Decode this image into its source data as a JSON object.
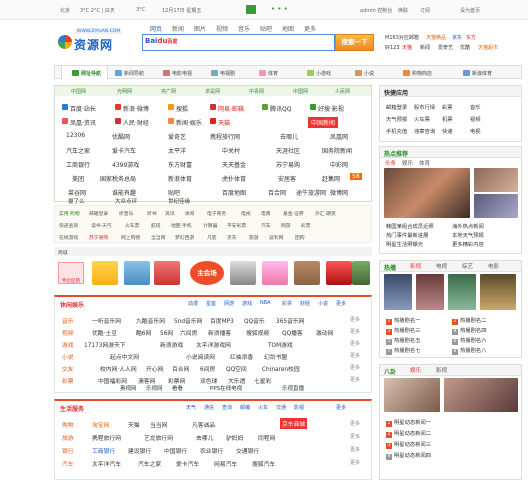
{
  "topbar": {
    "city": "北京",
    "weather": "3°C 2°C | 白天",
    "weather2": "3°C",
    "date": "12月17日 星期五",
    "user": "admin 控制台",
    "links": [
      "换肤",
      "订阅",
      "设为首页"
    ]
  },
  "logo": {
    "url": "WWW.ZIYUAN.COM",
    "name": "资源网"
  },
  "search_tabs": [
    "网页",
    "新闻",
    "图片",
    "视频",
    "音乐",
    "贴吧",
    "地图",
    "更多"
  ],
  "search": {
    "engine": "Baidu百度",
    "button": "搜索一下",
    "value": ""
  },
  "right_links": {
    "line1": [
      "M163对应邮箱",
      "天猫精品",
      "京东",
      "东方"
    ],
    "line2": [
      "好123",
      "天猫",
      "新闻",
      "爱奇艺",
      "优酷",
      "天猫超市"
    ]
  },
  "navbar": [
    "网址导航",
    "新闻导航",
    "电影电视",
    "电视剧",
    "体育",
    "小游戏",
    "小说",
    "购物商店",
    "新浪体育"
  ],
  "famous": {
    "head": [
      "中国网",
      "光明网",
      "央广网",
      "求是网",
      "中青网",
      "中国网",
      "人民网"
    ],
    "rows": [
      [
        "百度·站长",
        "新浪·微博",
        "搜狐",
        "网易·邮箱",
        "腾讯QQ",
        "好搜·影视"
      ],
      [
        "凤凰·资讯",
        "人民·财经",
        "新闻·娱乐",
        "天猫",
        "",
        "中国新闻"
      ],
      [
        "12306",
        "优酷网",
        "爱奇艺",
        "携程旅行网",
        "去哪儿",
        "凤凰网"
      ],
      [
        "汽车之家",
        "爱卡汽车",
        "太平洋",
        "中关村",
        "天涯社区",
        "国务院新闻"
      ],
      [
        "工商银行",
        "4399游戏",
        "东方财富",
        "天天基金",
        "苏宁易购",
        "中彩网"
      ],
      [
        "美团",
        "国家税务总局",
        "新浪体育",
        "虎扑体育",
        "安居客",
        "赶集网",
        "58"
      ],
      [
        "菜谷网",
        "谁能有趣",
        "贴吧",
        "百度地图",
        "百合网",
        "途牛旅游网",
        "微博网"
      ],
      [
        "拔了么",
        "大众点评",
        "世纪佳缘"
      ]
    ]
  },
  "categories": [
    [
      "实用·购物",
      "邮箱登录",
      "听音乐",
      "听书",
      "资讯",
      "体育",
      "电子商务",
      "电视",
      "电商",
      "基金·证券",
      "外汇·期货"
    ],
    [
      "快递查询",
      "读书·天气",
      "火车票",
      "航班",
      "地图·手机",
      "计算器",
      "平安彩票",
      "汽车",
      "网游",
      "彩票"
    ],
    [
      "在线游戏",
      "苏宁易购",
      "网上购物",
      "当当网",
      "梦幻西游",
      "凡客",
      "京东",
      "旅游",
      "返利网",
      "团购"
    ]
  ],
  "shop": {
    "head": "商城",
    "promo": "主会场",
    "tag": "特卖促销"
  },
  "leisure": {
    "title": "休闲娱乐",
    "links": [
      "动漫",
      "星座",
      "网游",
      "游戏",
      "NBA",
      "彩票",
      "财经",
      "小说",
      "更多"
    ],
    "rows": [
      [
        "音乐",
        "一听音乐网",
        "九酷音乐网",
        "5nd音乐网",
        "百度MP3",
        "QQ音乐",
        "365音乐网",
        "更多"
      ],
      [
        "视频",
        "优酷·土豆",
        "酷6网",
        "56网",
        "六间房",
        "新浪播客",
        "搜狐视频",
        "QQ播客",
        "激动网",
        "更多"
      ],
      [
        "游戏",
        "17173网游天下",
        "新浪游戏",
        "太平洋游戏网",
        "TOM游戏",
        "更多"
      ],
      [
        "小说",
        "起点中文网",
        "小说阅读网",
        "红袖添香",
        "幻剑书盟",
        "更多"
      ],
      [
        "交友",
        "校内网·人人网",
        "开心网",
        "百合网",
        "6间房",
        "QQ空间",
        "Chinaren校园",
        "更多"
      ],
      [
        "彩票",
        "中国福彩网",
        "澳客网",
        "彩票网",
        "双色球",
        "大乐透",
        "七星彩",
        "更多"
      ],
      [
        "",
        "",
        "奥视网",
        "乐视网",
        "看看",
        "PPS在线电视",
        "乐视直播"
      ]
    ]
  },
  "life": {
    "title": "生活服务",
    "links": [
      "天气",
      "通信",
      "查询",
      "邮编",
      "火车",
      "交通",
      "影视",
      "更多"
    ],
    "rows": [
      [
        "购物",
        "淘宝网",
        "天猫",
        "当当网",
        "凡客诚品",
        "京东商城",
        "更多"
      ],
      [
        "旅游",
        "携程旅行网",
        "艺龙旅行网",
        "去哪儿",
        "驴妈妈",
        "同程网",
        "更多"
      ],
      [
        "银行",
        "工商银行",
        "建设银行",
        "中国银行",
        "农业银行",
        "交通银行",
        "更多"
      ],
      [
        "汽车",
        "太平洋汽车",
        "汽车之家",
        "爱卡汽车",
        "网易汽车",
        "搜狐汽车",
        "更多"
      ]
    ]
  },
  "quick": {
    "title": "快捷应用",
    "items": [
      "邮箱登录",
      "股市行情",
      "彩票",
      "天气预报",
      "火车票",
      "机票",
      "手机充值",
      "违章查询",
      "快递",
      "音乐",
      "视频",
      "电视"
    ]
  },
  "hot": {
    "title": "热点推荐",
    "tabs": [
      "头条",
      "娱乐",
      "体育"
    ],
    "items": [
      "韩国某组合成员近照",
      "热门事件最新进展",
      "明星生活照曝光",
      "海外热点新闻",
      "本地天气预报",
      "更多精彩内容"
    ]
  },
  "trend": {
    "title": "热播",
    "tabs": [
      "影视",
      "电视",
      "综艺",
      "电影"
    ],
    "items": [
      "热播剧名一",
      "热播剧名二",
      "热播剧名三",
      "热播剧名四",
      "热播剧名五",
      "热播剧名六",
      "热播剧名七",
      "热播剧名八"
    ]
  },
  "star": {
    "title": "八卦",
    "tabs": [
      "娱乐",
      "影视"
    ],
    "items": [
      "明星动态新闻一",
      "明星动态新闻二",
      "明星动态新闻三",
      "明星动态新闻四"
    ]
  }
}
